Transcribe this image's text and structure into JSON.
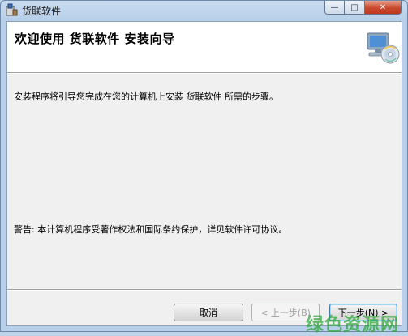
{
  "window": {
    "title": "货联软件",
    "controls": {
      "minimize": "—",
      "maximize": "□",
      "close": "✕"
    }
  },
  "banner": {
    "title": "欢迎使用 货联软件 安装向导",
    "icon": "computer-cd-icon"
  },
  "body": {
    "description": "安装程序将引导您完成在您的计算机上安装 货联软件 所需的步骤。",
    "warning": "警告: 本计算机程序受著作权法和国际条约保护，详见软件许可协议。"
  },
  "buttons": {
    "cancel": "取消",
    "back": "< 上一步(B)",
    "next": "下一步(N) >"
  },
  "watermark": "绿色资源网"
}
